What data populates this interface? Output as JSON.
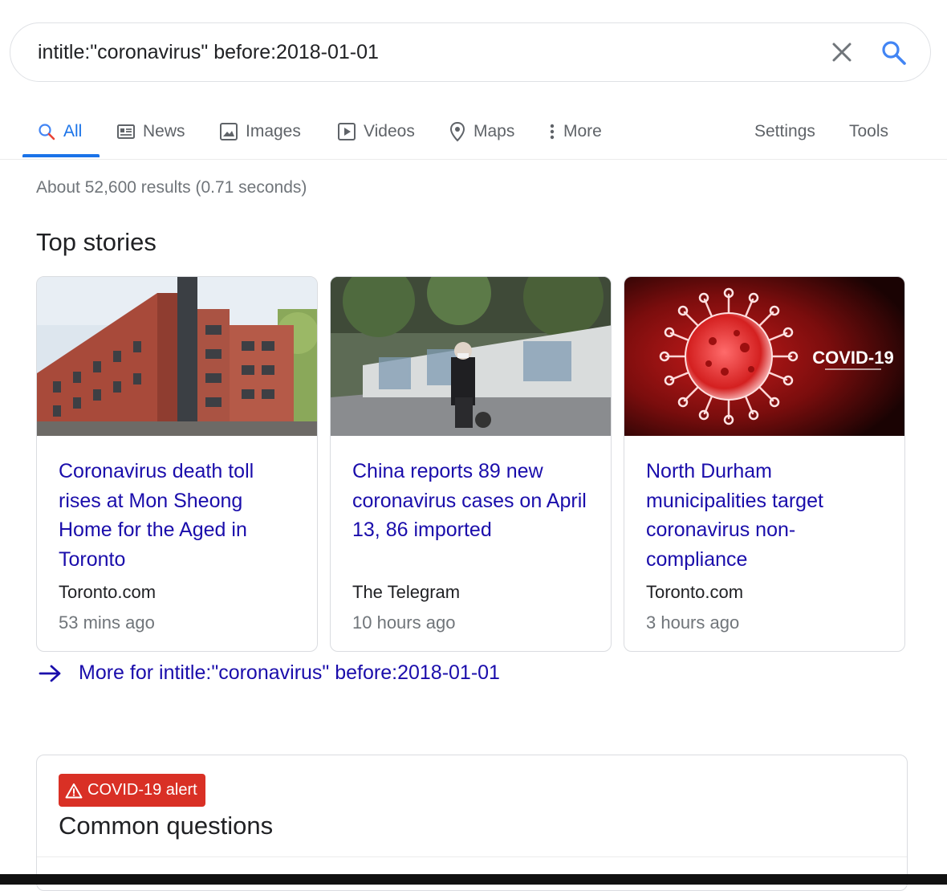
{
  "search": {
    "query": "intitle:\"coronavirus\" before:2018-01-01"
  },
  "tabs": [
    {
      "label": "All",
      "icon": "search-icon",
      "active": true
    },
    {
      "label": "News",
      "icon": "newspaper-icon"
    },
    {
      "label": "Images",
      "icon": "image-icon"
    },
    {
      "label": "Videos",
      "icon": "video-play-icon"
    },
    {
      "label": "Maps",
      "icon": "map-pin-icon"
    },
    {
      "label": "More",
      "icon": "vertical-dots-icon"
    }
  ],
  "tools": {
    "settings_label": "Settings",
    "tools_label": "Tools"
  },
  "result_stats": "About 52,600 results (0.71 seconds)",
  "top_stories": {
    "title": "Top stories",
    "stories": [
      {
        "title": "Coronavirus death toll rises at Mon Sheong Home for the Aged in Toronto",
        "source": "Toronto.com",
        "time": "53 mins ago",
        "image": "red-brick-care-home-building"
      },
      {
        "title": "China reports 89 new coronavirus cases on April 13, 86 imported",
        "source": "The Telegram",
        "time": "10 hours ago",
        "image": "masked-person-on-scooter-street"
      },
      {
        "title": "North Durham municipalities target coronavirus non-compliance",
        "source": "Toronto.com",
        "time": "3 hours ago",
        "image": "covid-19-virus-illustration",
        "image_text": "COVID-19"
      }
    ],
    "more_link": "More for intitle:\"coronavirus\" before:2018-01-01"
  },
  "common_questions": {
    "alert_badge": "COVID-19 alert",
    "title": "Common questions"
  },
  "colors": {
    "link": "#1a0dab",
    "accent": "#1a73e8",
    "alert": "#d93025",
    "muted": "#70757a"
  }
}
